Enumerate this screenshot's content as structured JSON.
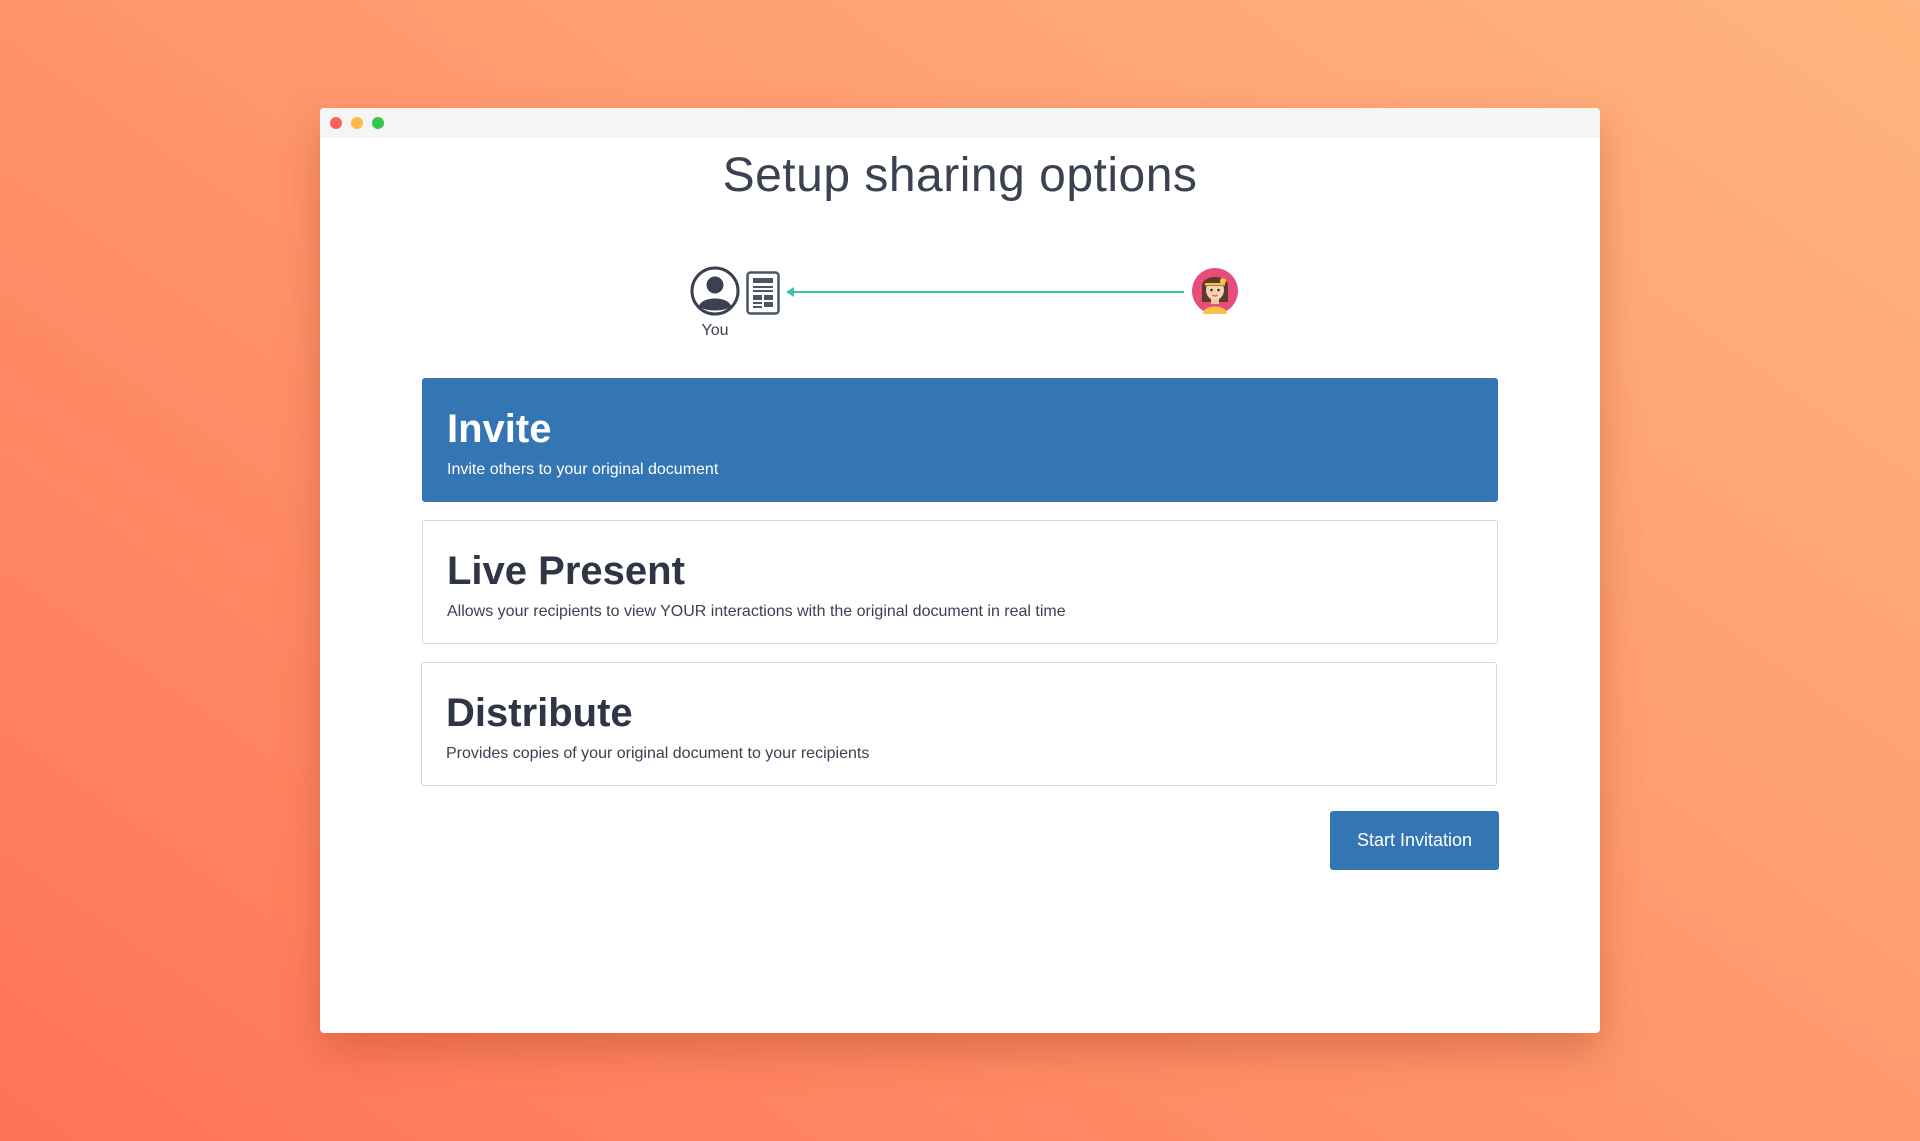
{
  "window": {
    "controls": [
      "close",
      "minimize",
      "maximize"
    ]
  },
  "page": {
    "title": "Setup sharing options"
  },
  "flow": {
    "sender_label": "You",
    "sender_icon": "user-circle-icon",
    "document_icon": "document-icon",
    "arrow_icon": "arrow-left-icon",
    "recipient_icon": "recipient-avatar-icon",
    "arrow_color": "#3cc0a8"
  },
  "options": [
    {
      "title": "Invite",
      "description": "Invite others to your original document",
      "selected": true
    },
    {
      "title": "Live Present",
      "description": "Allows your recipients to view YOUR interactions with the original document in real time",
      "selected": false
    },
    {
      "title": "Distribute",
      "description": "Provides copies of your original document to your recipients",
      "selected": false
    }
  ],
  "actions": {
    "start_label": "Start Invitation"
  },
  "colors": {
    "accent": "#3376b3",
    "text": "#3b4150",
    "background_start": "#ff7357",
    "background_end": "#ffb57d"
  }
}
